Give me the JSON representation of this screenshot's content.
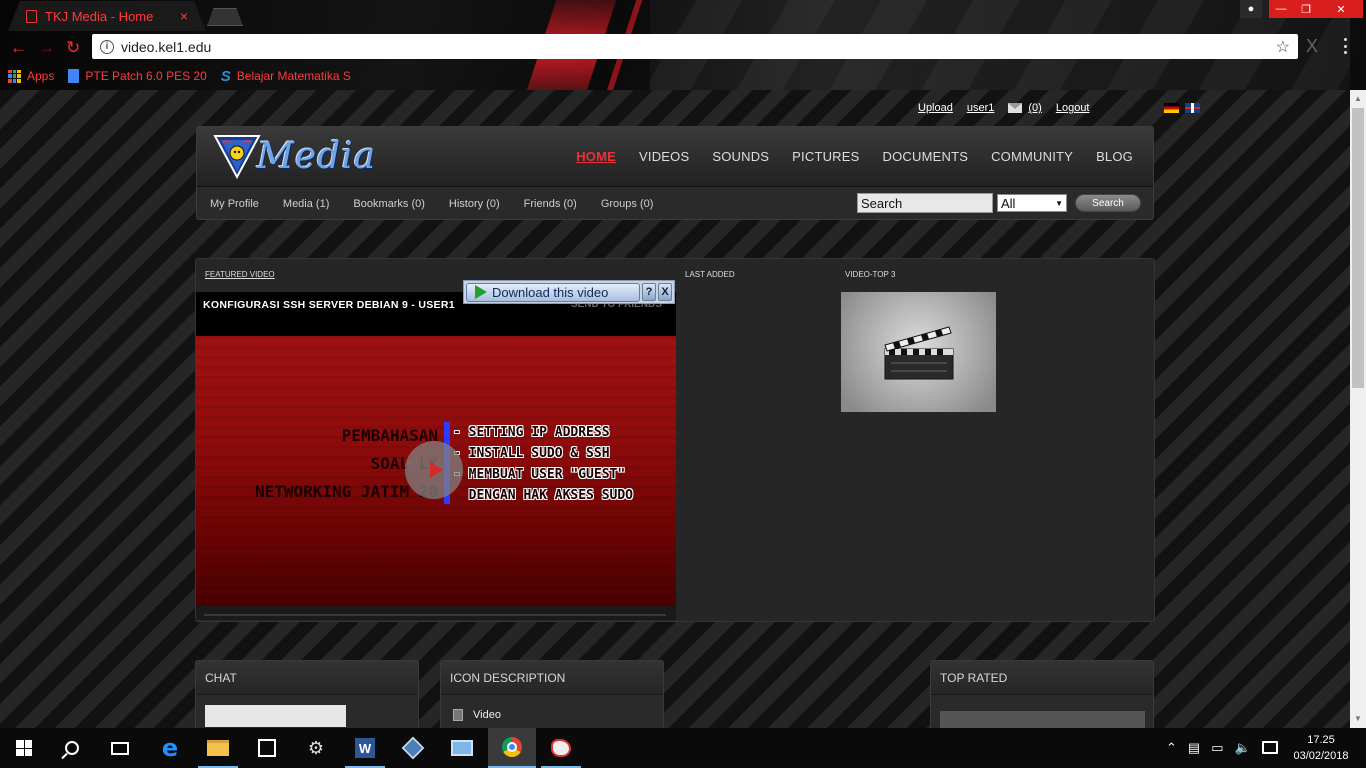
{
  "browser": {
    "tab_title": "TKJ Media - Home",
    "tab_close": "×",
    "url": "video.kel1.edu",
    "bookmarks": [
      {
        "label": "Apps",
        "icon": "apps-grid-icon"
      },
      {
        "label": "PTE Patch 6.0 PES 20",
        "icon": "google-docs-icon"
      },
      {
        "label": "Belajar Matematika S",
        "icon": "s-logo-icon"
      }
    ],
    "colors": {
      "accent": "#ff3b3b",
      "window_controls": "#d91e1e"
    }
  },
  "userbar": {
    "upload": "Upload",
    "username": "user1",
    "messages": "(0)",
    "logout": "Logout"
  },
  "site": {
    "logo_text": "Media",
    "nav": [
      "HOME",
      "VIDEOS",
      "SOUNDS",
      "PICTURES",
      "DOCUMENTS",
      "COMMUNITY",
      "BLOG"
    ],
    "active_nav": "HOME",
    "subnav": [
      "My Profile",
      "Media (1)",
      "Bookmarks (0)",
      "History (0)",
      "Friends (0)",
      "Groups (0)"
    ],
    "search_placeholder": "Search",
    "search_value": "Search",
    "search_scope": "All",
    "search_button": "Search",
    "accent_color": "#e3343a"
  },
  "featured": {
    "section_featured": "FEATURED VIDEO",
    "section_last": "LAST ADDED",
    "section_top3": "VIDEO-TOP 3",
    "video_title": "KONFIGURASI SSH SERVER DEBIAN 9 - USER1",
    "send_to_friends": "SEND TO FRIENDS",
    "video_left_lines": [
      "PEMBAHASAN",
      "SOAL LK",
      "NETWORKING JATIM 20"
    ],
    "video_right_lines": [
      "- SETTING IP ADDRESS",
      "- INSTALL SUDO & SSH",
      "- MEMBUAT USER \"GUEST\"",
      "  DENGAN HAK AKSES SUDO"
    ]
  },
  "download_popup": {
    "label": "Download this video",
    "help": "?",
    "close": "X"
  },
  "lower": {
    "chat_title": "CHAT",
    "icon_desc_title": "ICON DESCRIPTION",
    "icon_desc_items": [
      "Video"
    ],
    "top_rated_title": "TOP RATED"
  },
  "taskbar": {
    "time": "17.25",
    "date": "03/02/2018"
  }
}
